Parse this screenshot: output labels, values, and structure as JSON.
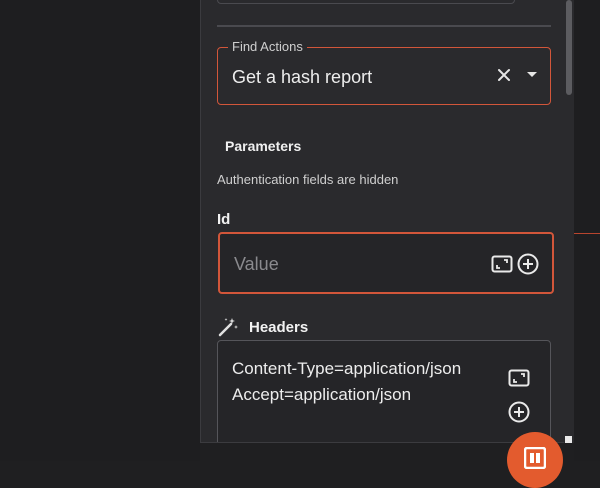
{
  "find_actions": {
    "legend": "Find Actions",
    "value": "Get a hash report"
  },
  "parameters": {
    "title": "Parameters",
    "helper": "Authentication fields are hidden"
  },
  "id_field": {
    "label": "Id",
    "placeholder": "Value"
  },
  "headers": {
    "label": "Headers",
    "lines": [
      "Content-Type=application/json",
      "Accept=application/json"
    ]
  },
  "colors": {
    "accent": "#d2563a",
    "fab": "#e35b2e",
    "panel_bg": "#2a2a2d",
    "canvas_bg": "#1e1e20"
  },
  "icons": [
    "clear-icon",
    "dropdown-arrow-icon",
    "expand-icon",
    "add-circle-icon",
    "magic-wand-icon",
    "app-logo-icon"
  ]
}
